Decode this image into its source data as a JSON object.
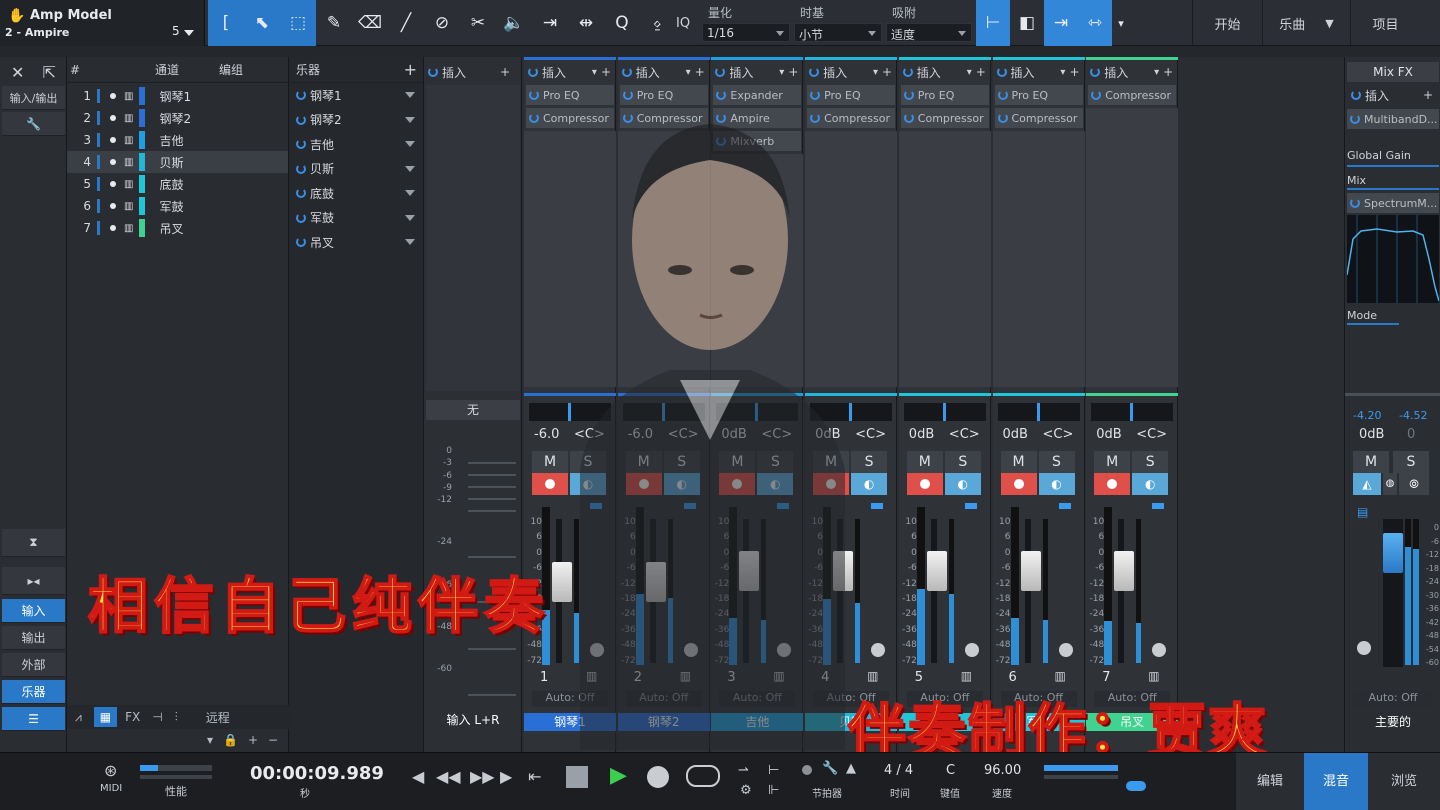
{
  "track_info": {
    "title": "Amp Model",
    "subtitle": "2 - Ampire",
    "number": "5"
  },
  "toolbar": {
    "iq": "IQ",
    "quantize_label": "量化",
    "quantize_value": "1/16",
    "timebase_label": "时基",
    "timebase_value": "小节",
    "snap_label": "吸附",
    "snap_value": "适度",
    "nav_start": "开始",
    "nav_song": "乐曲",
    "nav_project": "项目"
  },
  "left_panel": {
    "io_label": "输入/输出",
    "buttons": [
      "输入",
      "输出",
      "外部",
      "乐器"
    ]
  },
  "track_list": {
    "col_num": "#",
    "col_channel": "通道",
    "col_edit": "编组",
    "tracks": [
      {
        "num": "1",
        "name": "钢琴1",
        "color": "#2a6fd6"
      },
      {
        "num": "2",
        "name": "钢琴2",
        "color": "#2a6fd6"
      },
      {
        "num": "3",
        "name": "吉他",
        "color": "#1f9fe0"
      },
      {
        "num": "4",
        "name": "贝斯",
        "color": "#22b6d9"
      },
      {
        "num": "5",
        "name": "底鼓",
        "color": "#1fc6d8"
      },
      {
        "num": "6",
        "name": "军鼓",
        "color": "#1fc6d8"
      },
      {
        "num": "7",
        "name": "吊叉",
        "color": "#3fd38f"
      }
    ],
    "footer_remote": "远程",
    "footer_fx": "FX"
  },
  "instruments": {
    "header": "乐器",
    "items": [
      "钢琴1",
      "钢琴2",
      "吉他",
      "贝斯",
      "底鼓",
      "军鼓",
      "吊叉"
    ]
  },
  "mixer": {
    "insert_label": "插入",
    "input_strip": {
      "none_label": "无",
      "input_label": "输入 L+R",
      "scale": [
        "0",
        "-3",
        "-6",
        "-9",
        "-12",
        "-24",
        "-36",
        "-48",
        "-60"
      ]
    },
    "fader_scale": [
      "10",
      "6",
      "0",
      "-6",
      "-12",
      "-18",
      "-24",
      "-36",
      "-48",
      "-72"
    ],
    "mute": "M",
    "solo": "S",
    "auto": "Auto: Off",
    "channels": [
      {
        "num": "1",
        "name": "钢琴1",
        "volume": "-6.0",
        "pan": "<C>",
        "color": "#2a6fd6",
        "plugins": [
          "Pro EQ",
          "Compressor"
        ],
        "meter": 0.35,
        "fader": 0.68
      },
      {
        "num": "2",
        "name": "钢琴2",
        "volume": "-6.0",
        "pan": "<C>",
        "color": "#2a6fd6",
        "plugins": [
          "Pro EQ",
          "Compressor"
        ],
        "meter": 0.45,
        "fader": 0.68
      },
      {
        "num": "3",
        "name": "吉他",
        "volume": "0dB",
        "pan": "<C>",
        "color": "#1f9fe0",
        "plugins": [
          "Expander",
          "Ampire",
          "Mixverb"
        ],
        "meter": 0.3,
        "fader": 0.78
      },
      {
        "num": "4",
        "name": "贝斯",
        "volume": "0dB",
        "pan": "<C>",
        "color": "#22b6d9",
        "plugins": [
          "Pro EQ",
          "Compressor"
        ],
        "meter": 0.42,
        "fader": 0.78
      },
      {
        "num": "5",
        "name": "底鼓",
        "volume": "0dB",
        "pan": "<C>",
        "color": "#1fc6d8",
        "plugins": [
          "Pro EQ",
          "Compressor"
        ],
        "meter": 0.48,
        "fader": 0.78
      },
      {
        "num": "6",
        "name": "军鼓",
        "volume": "0dB",
        "pan": "<C>",
        "color": "#1fc6d8",
        "plugins": [
          "Pro EQ",
          "Compressor"
        ],
        "meter": 0.3,
        "fader": 0.78
      },
      {
        "num": "7",
        "name": "吊叉",
        "volume": "0dB",
        "pan": "<C>",
        "color": "#3fd38f",
        "plugins": [
          "Compressor"
        ],
        "meter": 0.28,
        "fader": 0.78
      }
    ]
  },
  "main_bus": {
    "mixfx": "Mix FX",
    "insert": "插入",
    "plugin": "MultibandD...",
    "global_gain": "Global Gain",
    "mix": "Mix",
    "spectrum": "SpectrumM...",
    "mode": "Mode",
    "peak_l": "-4.20",
    "peak_r": "-4.52",
    "volume": "0dB",
    "pan": "0",
    "scale": [
      "0",
      "-6",
      "-12",
      "-18",
      "-24",
      "-30",
      "-36",
      "-42",
      "-48",
      "-54",
      "-60"
    ],
    "auto": "Auto: Off",
    "name": "主要的"
  },
  "transport": {
    "midi": "MIDI",
    "performance": "性能",
    "time": "00:00:09.989",
    "time_unit": "秒",
    "metronome": "节拍器",
    "signature": "4 / 4",
    "signature_label": "时间",
    "key": "C",
    "key_label": "键值",
    "tempo": "96.00",
    "tempo_label": "速度",
    "tab_edit": "编辑",
    "tab_mix": "混音",
    "tab_browse": "浏览"
  },
  "overlay": {
    "caption_left": "相信自己纯伴奏",
    "caption_right": "伴奏制作：贾爽"
  }
}
